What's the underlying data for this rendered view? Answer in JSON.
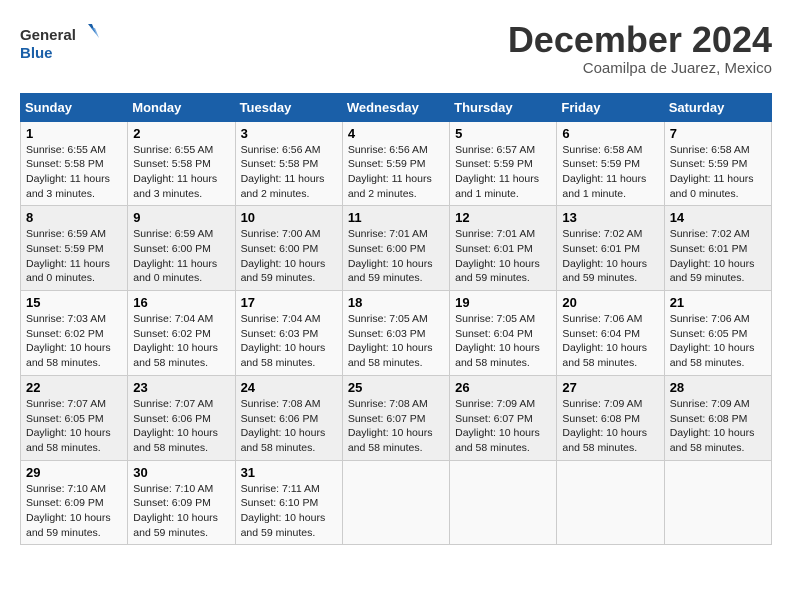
{
  "header": {
    "logo_line1": "General",
    "logo_line2": "Blue",
    "month": "December 2024",
    "location": "Coamilpa de Juarez, Mexico"
  },
  "weekdays": [
    "Sunday",
    "Monday",
    "Tuesday",
    "Wednesday",
    "Thursday",
    "Friday",
    "Saturday"
  ],
  "weeks": [
    [
      {
        "day": "1",
        "info": "Sunrise: 6:55 AM\nSunset: 5:58 PM\nDaylight: 11 hours and 3 minutes."
      },
      {
        "day": "2",
        "info": "Sunrise: 6:55 AM\nSunset: 5:58 PM\nDaylight: 11 hours and 3 minutes."
      },
      {
        "day": "3",
        "info": "Sunrise: 6:56 AM\nSunset: 5:58 PM\nDaylight: 11 hours and 2 minutes."
      },
      {
        "day": "4",
        "info": "Sunrise: 6:56 AM\nSunset: 5:59 PM\nDaylight: 11 hours and 2 minutes."
      },
      {
        "day": "5",
        "info": "Sunrise: 6:57 AM\nSunset: 5:59 PM\nDaylight: 11 hours and 1 minute."
      },
      {
        "day": "6",
        "info": "Sunrise: 6:58 AM\nSunset: 5:59 PM\nDaylight: 11 hours and 1 minute."
      },
      {
        "day": "7",
        "info": "Sunrise: 6:58 AM\nSunset: 5:59 PM\nDaylight: 11 hours and 0 minutes."
      }
    ],
    [
      {
        "day": "8",
        "info": "Sunrise: 6:59 AM\nSunset: 5:59 PM\nDaylight: 11 hours and 0 minutes."
      },
      {
        "day": "9",
        "info": "Sunrise: 6:59 AM\nSunset: 6:00 PM\nDaylight: 11 hours and 0 minutes."
      },
      {
        "day": "10",
        "info": "Sunrise: 7:00 AM\nSunset: 6:00 PM\nDaylight: 10 hours and 59 minutes."
      },
      {
        "day": "11",
        "info": "Sunrise: 7:01 AM\nSunset: 6:00 PM\nDaylight: 10 hours and 59 minutes."
      },
      {
        "day": "12",
        "info": "Sunrise: 7:01 AM\nSunset: 6:01 PM\nDaylight: 10 hours and 59 minutes."
      },
      {
        "day": "13",
        "info": "Sunrise: 7:02 AM\nSunset: 6:01 PM\nDaylight: 10 hours and 59 minutes."
      },
      {
        "day": "14",
        "info": "Sunrise: 7:02 AM\nSunset: 6:01 PM\nDaylight: 10 hours and 59 minutes."
      }
    ],
    [
      {
        "day": "15",
        "info": "Sunrise: 7:03 AM\nSunset: 6:02 PM\nDaylight: 10 hours and 58 minutes."
      },
      {
        "day": "16",
        "info": "Sunrise: 7:04 AM\nSunset: 6:02 PM\nDaylight: 10 hours and 58 minutes."
      },
      {
        "day": "17",
        "info": "Sunrise: 7:04 AM\nSunset: 6:03 PM\nDaylight: 10 hours and 58 minutes."
      },
      {
        "day": "18",
        "info": "Sunrise: 7:05 AM\nSunset: 6:03 PM\nDaylight: 10 hours and 58 minutes."
      },
      {
        "day": "19",
        "info": "Sunrise: 7:05 AM\nSunset: 6:04 PM\nDaylight: 10 hours and 58 minutes."
      },
      {
        "day": "20",
        "info": "Sunrise: 7:06 AM\nSunset: 6:04 PM\nDaylight: 10 hours and 58 minutes."
      },
      {
        "day": "21",
        "info": "Sunrise: 7:06 AM\nSunset: 6:05 PM\nDaylight: 10 hours and 58 minutes."
      }
    ],
    [
      {
        "day": "22",
        "info": "Sunrise: 7:07 AM\nSunset: 6:05 PM\nDaylight: 10 hours and 58 minutes."
      },
      {
        "day": "23",
        "info": "Sunrise: 7:07 AM\nSunset: 6:06 PM\nDaylight: 10 hours and 58 minutes."
      },
      {
        "day": "24",
        "info": "Sunrise: 7:08 AM\nSunset: 6:06 PM\nDaylight: 10 hours and 58 minutes."
      },
      {
        "day": "25",
        "info": "Sunrise: 7:08 AM\nSunset: 6:07 PM\nDaylight: 10 hours and 58 minutes."
      },
      {
        "day": "26",
        "info": "Sunrise: 7:09 AM\nSunset: 6:07 PM\nDaylight: 10 hours and 58 minutes."
      },
      {
        "day": "27",
        "info": "Sunrise: 7:09 AM\nSunset: 6:08 PM\nDaylight: 10 hours and 58 minutes."
      },
      {
        "day": "28",
        "info": "Sunrise: 7:09 AM\nSunset: 6:08 PM\nDaylight: 10 hours and 58 minutes."
      }
    ],
    [
      {
        "day": "29",
        "info": "Sunrise: 7:10 AM\nSunset: 6:09 PM\nDaylight: 10 hours and 59 minutes."
      },
      {
        "day": "30",
        "info": "Sunrise: 7:10 AM\nSunset: 6:09 PM\nDaylight: 10 hours and 59 minutes."
      },
      {
        "day": "31",
        "info": "Sunrise: 7:11 AM\nSunset: 6:10 PM\nDaylight: 10 hours and 59 minutes."
      },
      null,
      null,
      null,
      null
    ]
  ]
}
